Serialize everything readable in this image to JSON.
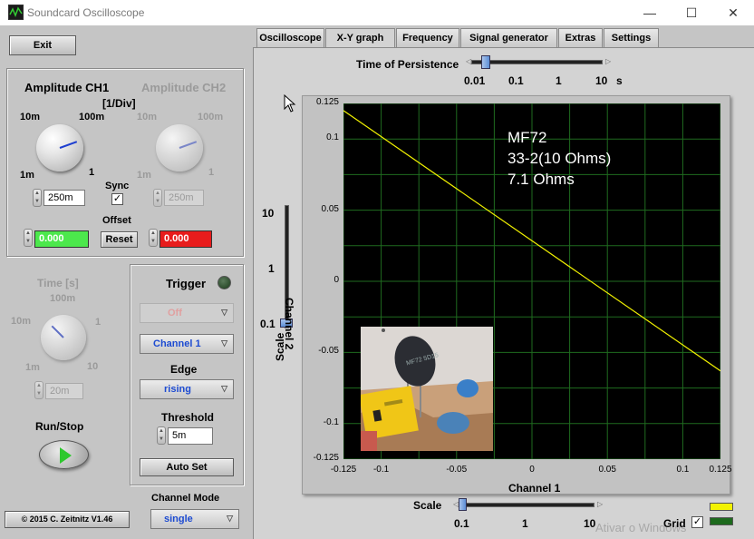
{
  "window": {
    "title": "Soundcard Oscilloscope",
    "minimize": "—",
    "maximize": "☐",
    "close": "✕"
  },
  "left": {
    "exit_label": "Exit",
    "amp_ch1_title": "Amplitude CH1",
    "amp_ch2_title": "Amplitude CH2",
    "amp_unit": "[1/Div]",
    "knob_ch1": {
      "label_10m": "10m",
      "label_100m": "100m",
      "label_1m": "1m",
      "label_1": "1",
      "value": "250m"
    },
    "knob_ch2": {
      "label_10m": "10m",
      "label_100m": "100m",
      "label_1m": "1m",
      "label_1": "1",
      "value": "250m"
    },
    "sync_label": "Sync",
    "sync_checked": "✓",
    "offset_label": "Offset",
    "offset_ch1": "0.000",
    "offset_ch2": "0.000",
    "reset_label": "Reset",
    "time_title": "Time [s]",
    "time_knob": {
      "label_10m": "10m",
      "label_100m": "100m",
      "label_1m": "1m",
      "label_1": "1",
      "label_10": "10",
      "value": "20m"
    },
    "run_stop_label": "Run/Stop",
    "copyright": "© 2015  C. Zeitnitz V1.46",
    "channel_mode_label": "Channel Mode",
    "channel_mode_value": "single"
  },
  "trigger": {
    "title": "Trigger",
    "mode": "Off",
    "channel": "Channel 1",
    "edge_label": "Edge",
    "edge": "rising",
    "threshold_label": "Threshold",
    "threshold": "5m",
    "autoset_label": "Auto Set"
  },
  "tabs": [
    "Oscilloscope",
    "X-Y graph",
    "Frequency",
    "Signal generator",
    "Extras",
    "Settings"
  ],
  "persistence": {
    "label": "Time of Persistence",
    "ticks": [
      "0.01",
      "0.1",
      "1",
      "10"
    ],
    "unit": "s",
    "value": 0.01
  },
  "scale_vertical": {
    "label": "Scale",
    "ticks": [
      "10",
      "1",
      "0.1"
    ],
    "value": 0.1
  },
  "scale_horizontal": {
    "label": "Scale",
    "ticks": [
      "0.1",
      "1",
      "10"
    ],
    "value": 0.1
  },
  "grid_label": "Grid",
  "grid_checked": "✓",
  "colors": {
    "ch1_trace": "#f2f200",
    "ch2_trace": "#1d6a1d",
    "offset_ch1_bg": "#4ce84c",
    "offset_ch2_bg": "#e81c1c",
    "plot_bg": "#000000",
    "grid": "#1f6b1f"
  },
  "annotation": {
    "line1": "MF72",
    "line2": "33-2(10 Ohms)",
    "line3": "7.1 Ohms"
  },
  "photo_label": "MF72 5D15",
  "watermark": "Ativar o Windows",
  "chart_data": {
    "type": "line",
    "xlabel": "Channel 1",
    "ylabel": "Channel 2",
    "xlim": [
      -0.125,
      0.125
    ],
    "ylim": [
      -0.125,
      0.125
    ],
    "xticks": [
      "-0.125",
      "-0.1",
      "-0.05",
      "0",
      "0.05",
      "0.1",
      "0.125"
    ],
    "yticks": [
      "0.125",
      "0.1",
      "0.05",
      "0",
      "-0.05",
      "-0.1",
      "-0.125"
    ],
    "grid": true,
    "series": [
      {
        "values": [
          [
            -0.125,
            0.12
          ],
          [
            0.125,
            -0.063
          ]
        ]
      }
    ]
  }
}
